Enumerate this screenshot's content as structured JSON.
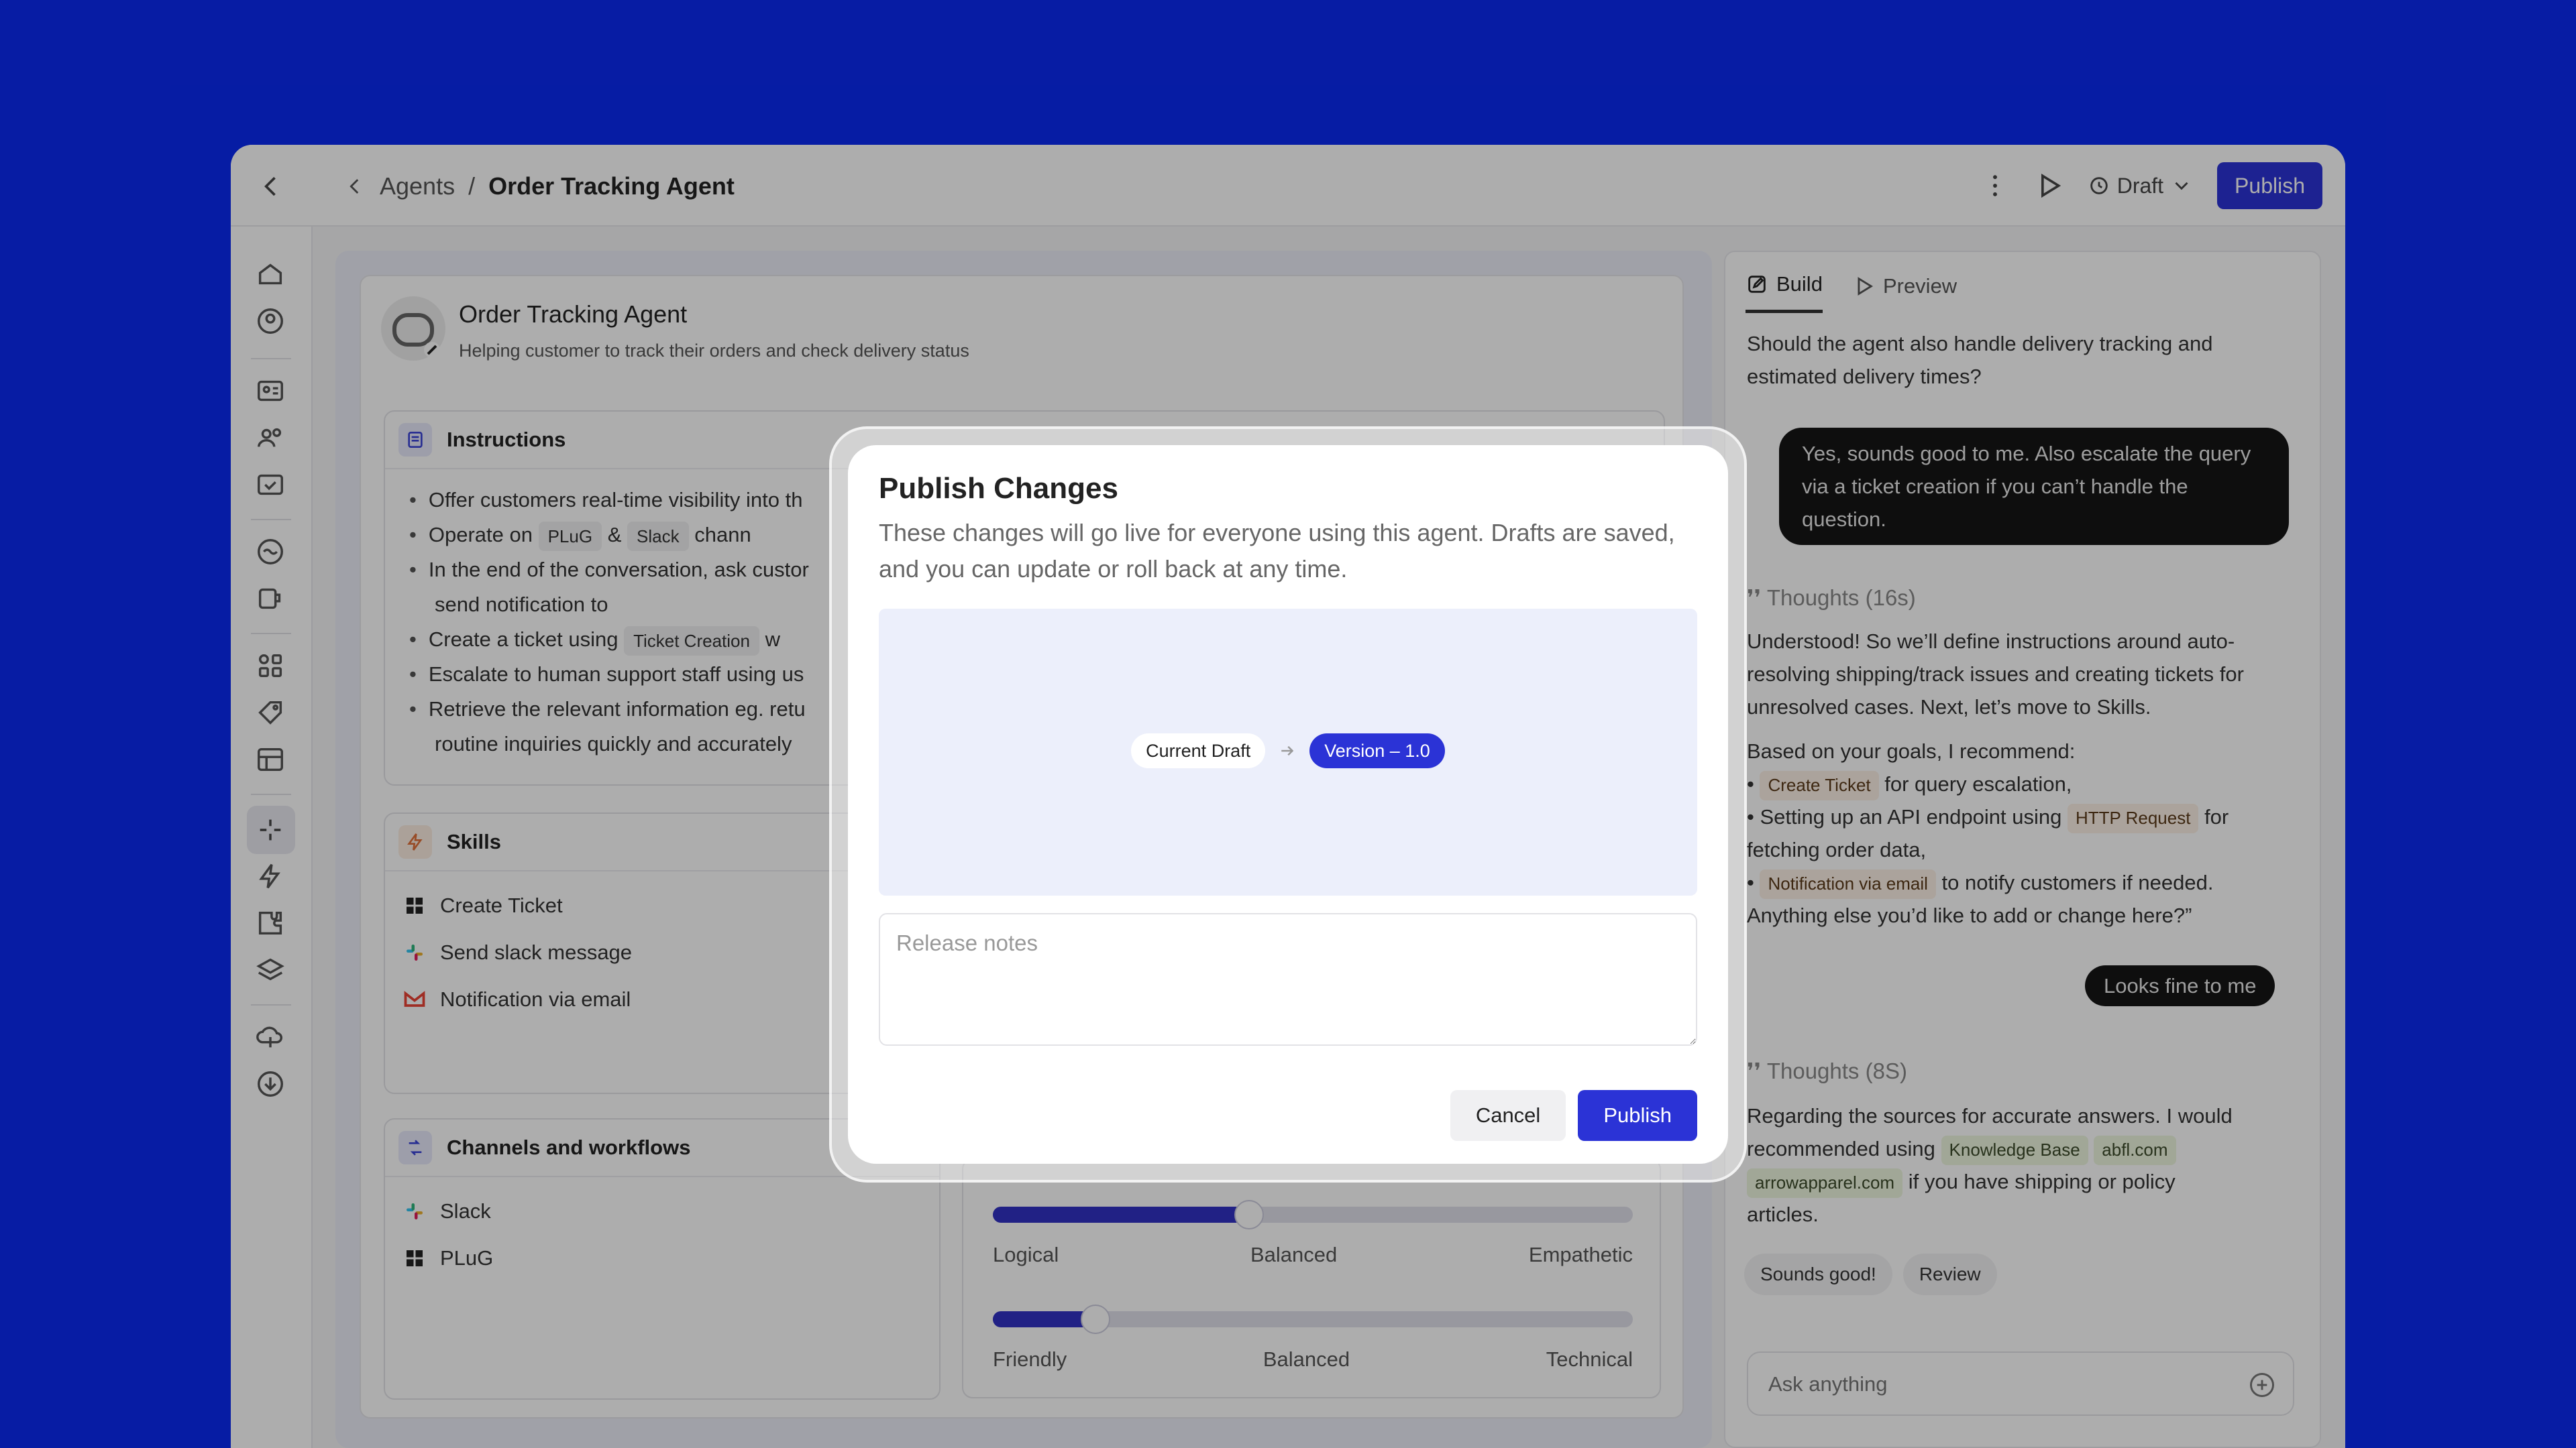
{
  "topbar": {
    "breadcrumb_root": "Agents",
    "breadcrumb_sep": "/",
    "breadcrumb_current": "Order Tracking Agent",
    "draft_label": "Draft",
    "publish_label": "Publish"
  },
  "agent": {
    "name": "Order Tracking Agent",
    "description": "Helping customer to track their orders and check delivery status"
  },
  "instructions": {
    "title": "Instructions",
    "b1": "Offer customers real-time visibility into th",
    "b2_prefix": "Operate on",
    "b2_chip1": "PLuG",
    "b2_amp": "&",
    "b2_chip2": "Slack",
    "b2_suffix": "chann",
    "b3_line1": "In the end of the conversation, ask custor",
    "b3_line2": "send notification to",
    "b4_prefix": "Create a ticket using",
    "b4_chip": "Ticket Creation",
    "b4_suffix": "w",
    "b5": "Escalate to human support staff using us",
    "b6_line1": "Retrieve the relevant information eg. retu",
    "b6_line2": "routine inquiries quickly and accurately"
  },
  "skills": {
    "title": "Skills",
    "items": [
      "Create Ticket",
      "Send slack message",
      "Notification via email"
    ]
  },
  "channels": {
    "title": "Channels and workflows",
    "items": [
      "Slack",
      "PLuG"
    ]
  },
  "tone": {
    "slider1": {
      "left": "Logical",
      "mid": "Balanced",
      "right": "Empathetic",
      "value": 0.4
    },
    "slider2": {
      "left": "Friendly",
      "mid": "Balanced",
      "right": "Technical",
      "value": 0.16
    }
  },
  "chat": {
    "tab_build": "Build",
    "tab_preview": "Preview",
    "q1": "Should the agent also handle delivery tracking and estimated delivery times?",
    "user1": "Yes, sounds good to me. Also escalate the query via a ticket creation if you can’t handle the question.",
    "thoughts1": "Thoughts (16s)",
    "a1": "Understood! So we’ll define instructions around auto-resolving shipping/track issues and creating tickets for unresolved cases. Next, let’s move to Skills.",
    "a2_intro": "Based on your goals, I recommend:",
    "a2_tag1": "Create Ticket",
    "a2_l1_suffix": "for query escalation,",
    "a2_l2_prefix": "Setting up an API endpoint using",
    "a2_tag2": "HTTP Request",
    "a2_l2_suffix": "for",
    "a2_l2_cont": "fetching order data,",
    "a2_tag3": "Notification via email",
    "a2_l3_suffix": "to notify customers if needed.",
    "a2_end": "Anything else you’d like to add or change here?”",
    "user2": "Looks fine to me",
    "thoughts2": "Thoughts (8S)",
    "a3_l1": "Regarding the sources for accurate answers. I would",
    "a3_l2_prefix": "recommended using",
    "a3_tag1": "Knowledge Base",
    "a3_tag2": "abfl.com",
    "a3_tag3": "arrowapparel.com",
    "a3_l3_suffix": "if you have shipping or policy",
    "a3_l4": "articles.",
    "suggestion1": "Sounds good!",
    "suggestion2": "Review",
    "ask_placeholder": "Ask anything"
  },
  "modal": {
    "title": "Publish Changes",
    "description": "These changes will go live for everyone using this agent. Drafts are saved, and you can update or roll back at any time.",
    "current_label": "Current Draft",
    "next_label": "Version – 1.0",
    "notes_placeholder": "Release notes",
    "cancel_label": "Cancel",
    "publish_label": "Publish"
  },
  "colors": {
    "background": "#0a2af2",
    "accent": "#2b33d6",
    "bubble": "#151515"
  }
}
